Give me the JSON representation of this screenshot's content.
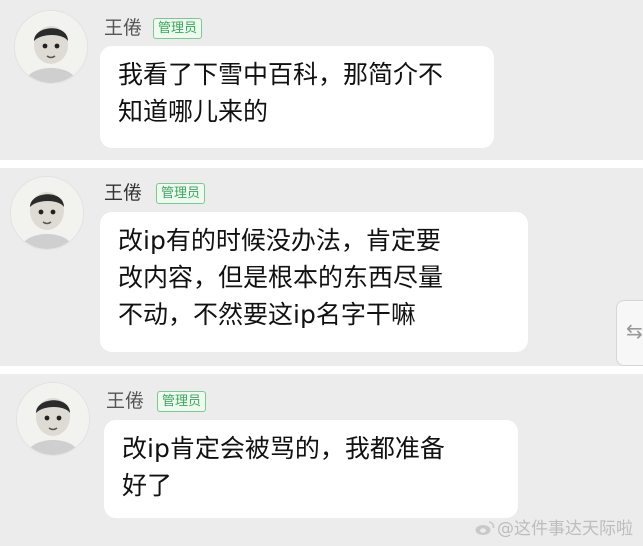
{
  "messages": [
    {
      "sender": "王倦",
      "badge": "管理员",
      "lines": [
        "我看了下雪中百科，那简介不",
        "知道哪儿来的"
      ]
    },
    {
      "sender": "王倦",
      "badge": "管理员",
      "lines": [
        "改ip有的时候没办法，肯定要",
        "改内容，但是根本的东西尽量",
        "不动，不然要这ip名字干嘛"
      ]
    },
    {
      "sender": "王倦",
      "badge": "管理员",
      "lines": [
        "改ip肯定会被骂的，我都准备",
        "好了"
      ]
    }
  ],
  "side_handle": {
    "glyph": "⇆"
  },
  "watermark": {
    "text": "@这件事达天际啦",
    "logo_icon": "weibo-logo-icon"
  },
  "colors": {
    "background": "#ececec",
    "bubble": "#ffffff",
    "badge_green": "#3aa85a"
  }
}
